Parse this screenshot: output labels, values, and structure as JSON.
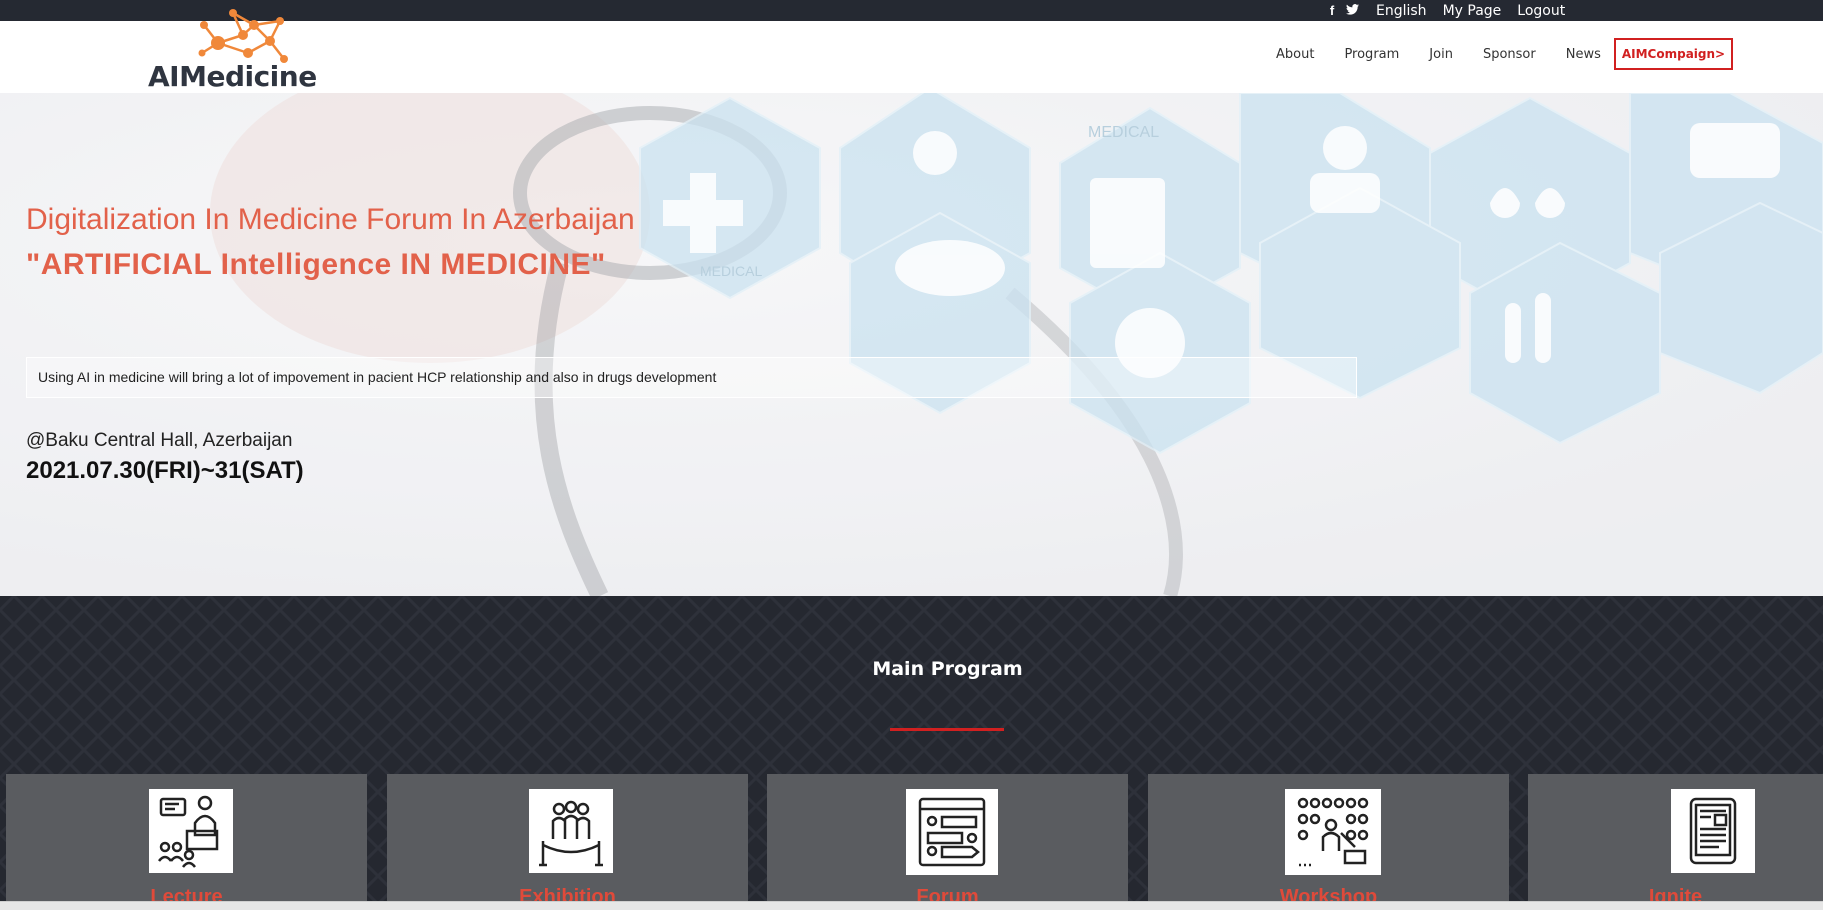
{
  "topbar": {
    "facebook_icon": "f",
    "twitter_icon": "🐦",
    "language": "English",
    "my_page": "My Page",
    "logout": "Logout"
  },
  "header": {
    "logo_text": "AIMedicine",
    "nav": [
      {
        "label": "About"
      },
      {
        "label": "Program"
      },
      {
        "label": "Join"
      },
      {
        "label": "Sponsor"
      },
      {
        "label": "News"
      },
      {
        "label": "AIMCompaign>"
      }
    ]
  },
  "hero": {
    "title": "Digitalization In Medicine Forum In Azerbaijan",
    "subtitle": "\"ARTIFICIAL Intelligence IN MEDICINE\"",
    "description": "Using AI in medicine will bring a lot of impovement in pacient HCP relationship and also in drugs development",
    "venue": "@Baku Central Hall, Azerbaijan",
    "date": "2021.07.30(FRI)~31(SAT)",
    "hexagon_labels": [
      "MEDICAL",
      "MEDICAL"
    ]
  },
  "program": {
    "title": "Main Program",
    "cards": [
      {
        "label": "Lecture",
        "icon": "lecture-icon"
      },
      {
        "label": "Exhibition",
        "icon": "exhibition-icon"
      },
      {
        "label": "Forum",
        "icon": "forum-icon"
      },
      {
        "label": "Workshop",
        "icon": "workshop-icon"
      },
      {
        "label": "Ignite",
        "icon": "ignite-icon"
      }
    ]
  },
  "colors": {
    "accent_red": "#d12020",
    "hero_text": "#e2614a",
    "dark_bar": "#252932"
  }
}
